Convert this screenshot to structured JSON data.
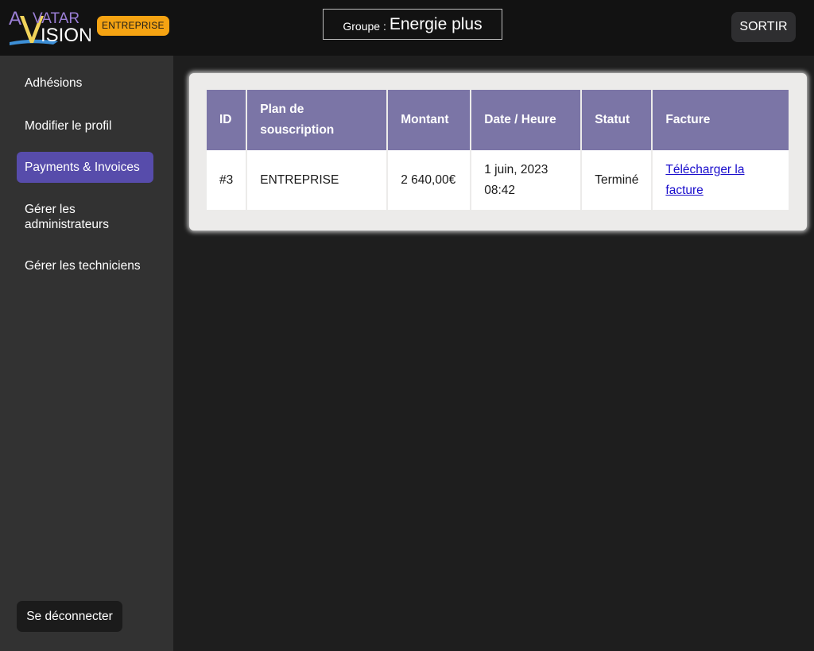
{
  "header": {
    "logo": {
      "line1": "VATAR",
      "line2": "ISION",
      "letters": "AV"
    },
    "plan_badge": "ENTREPRISE",
    "group_label": "Groupe :",
    "group_name": "Energie plus",
    "exit_label": "SORTIR"
  },
  "sidebar": {
    "items": [
      {
        "label": "Adhésions",
        "active": false
      },
      {
        "label": "Modifier le profil",
        "active": false
      },
      {
        "label": "Payments & Invoices",
        "active": true
      },
      {
        "label": "Gérer les administrateurs",
        "active": false
      },
      {
        "label": "Gérer les techniciens",
        "active": false
      }
    ],
    "logout_label": "Se déconnecter"
  },
  "payments_table": {
    "columns": [
      "ID",
      "Plan de souscription",
      "Montant",
      "Date / Heure",
      "Statut",
      "Facture"
    ],
    "rows": [
      {
        "id": "#3",
        "plan": "ENTREPRISE",
        "amount": "2 640,00€",
        "date_time": "1 juin, 2023 08:42",
        "status": "Terminé",
        "invoice_link": "Télécharger la facture"
      }
    ]
  },
  "colors": {
    "header_bg": "#121212",
    "sidebar_bg": "#323232",
    "main_bg": "#1e1e1e",
    "accent": "#574cab",
    "badge": "#f5a312",
    "table_header": "#7b75a6",
    "logo_purple": "#9b7fd6"
  }
}
